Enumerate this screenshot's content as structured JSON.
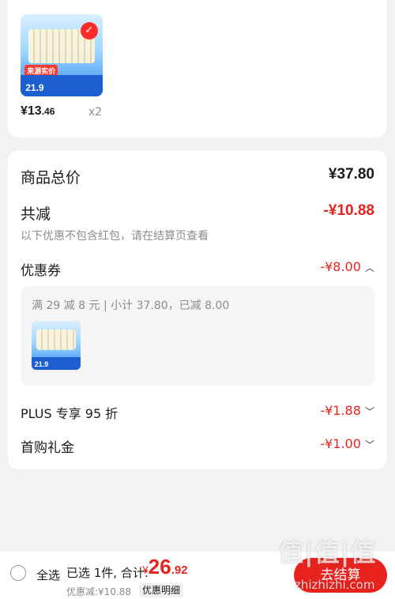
{
  "product_card": {
    "image_promo": "来源实价",
    "image_price": "21.9",
    "price_symbol": "¥",
    "price_int": "13",
    "price_dec": ".46",
    "quantity": "x2"
  },
  "summary": {
    "total_label": "商品总价",
    "total_value": "¥37.80",
    "discount_label": "共减",
    "discount_value": "-¥10.88",
    "discount_note": "以下优惠不包含红包，请在结算页查看",
    "coupon_label": "优惠券",
    "coupon_value": "-¥8.00",
    "coupon_detail": "满 29 减 8 元 | 小计 37.80，已减 8.00",
    "coupon_image_price": "21.9",
    "plus_label": "PLUS 专享 95 折",
    "plus_value": "-¥1.88",
    "first_label": "首购礼金",
    "first_value": "-¥1.00"
  },
  "bottom_bar": {
    "select_all": "全选",
    "selected": "已选 1件, 合计:",
    "total_symbol": "¥",
    "total_int": "26",
    "total_dec": ".92",
    "discount_text": "优惠减:¥10.88",
    "detail_button": "优惠明细",
    "checkout_button": "去结算"
  },
  "watermark": {
    "logo": "值|值|值",
    "site": "zhizhizhi.com"
  },
  "colors": {
    "accent_red": "#e8231e",
    "background": "#f2f2f2"
  }
}
